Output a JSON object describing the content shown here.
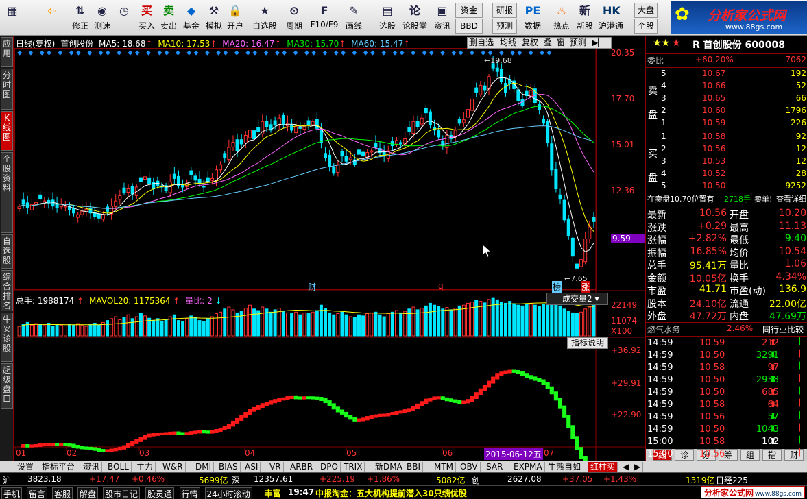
{
  "toolbar": {
    "buttons": [
      {
        "label": "",
        "icon": "grid-icon"
      },
      {
        "label": "",
        "icon": "back-arrow-icon"
      },
      {
        "label": "修正",
        "icon": "up-down-icon"
      },
      {
        "label": "测速",
        "icon": "speed-icon"
      },
      {
        "label": "",
        "icon": "clock-icon"
      },
      {
        "label": "买入",
        "icon": "buy-icon",
        "glyph": "买"
      },
      {
        "label": "卖出",
        "icon": "sell-icon",
        "glyph": "卖"
      },
      {
        "label": "基金",
        "icon": "fund-icon"
      },
      {
        "label": "模拟",
        "icon": "hammer-icon"
      },
      {
        "label": "开户",
        "icon": "lock-icon"
      },
      {
        "label": "自选股",
        "icon": "star-list-icon"
      },
      {
        "label": "周期",
        "icon": "period-icon"
      },
      {
        "label": "F10/F9",
        "icon": "f10-icon"
      },
      {
        "label": "画线",
        "icon": "pen-icon"
      },
      {
        "label": "选股",
        "icon": "select-icon"
      },
      {
        "label": "论股堂",
        "icon": "discuss-icon"
      },
      {
        "label": "资讯",
        "icon": "news-icon"
      },
      {
        "label": "资金",
        "icon": "funds-icon"
      },
      {
        "label": "BBD",
        "icon": "bbd-icon"
      },
      {
        "label": "研报",
        "icon": "report-icon"
      },
      {
        "label": "预测",
        "icon": "forecast-icon"
      },
      {
        "label": "数据",
        "icon": "pe-icon",
        "glyph": "PE"
      },
      {
        "label": "热点",
        "icon": "fire-icon"
      },
      {
        "label": "新股",
        "icon": "new-stock-icon"
      },
      {
        "label": "沪港通",
        "icon": "hk-icon"
      },
      {
        "label": "大盘",
        "icon": "market-icon"
      },
      {
        "label": "个股",
        "icon": "stock-icon"
      }
    ],
    "brand": "分析家公式网",
    "brand_url": "www.88gs.com"
  },
  "lefttabs": [
    "应用",
    "分时图",
    "K线图",
    "个股资料",
    "自选股",
    "综合排名",
    "牛叉诊股",
    "超级盘口"
  ],
  "chart": {
    "header": {
      "period": "日线(复权)",
      "name": "首创股份",
      "ma5": "MA5: 18.68",
      "ma10": "MA10: 17.53",
      "ma20": "MA20: 16.47",
      "ma30": "MA30: 15.70",
      "ma60": "MA60: 15.47"
    },
    "tools": [
      "删自选",
      "均线",
      "复权",
      "叠",
      "窗",
      "预测"
    ],
    "price_axis": [
      "20.35",
      "17.70",
      "15.01",
      "12.36",
      "9.59"
    ],
    "hi_label": "19.68",
    "lo_label": "7.65",
    "marks": [
      "财",
      "q",
      "榜",
      "涨"
    ],
    "vol_header": {
      "total": "总手: 1988174",
      "mavol": "MAVOL20: 1175364",
      "ratio": "量比: 2"
    },
    "vol_selector": "成交量2",
    "vol_axis": [
      "22149",
      "11074",
      "X100"
    ],
    "ind_btn": "指标说明",
    "ind_axis": [
      "+36.92",
      "+29.91",
      "+22.90"
    ],
    "months": [
      "01",
      "02",
      "03",
      "04",
      "05",
      "06",
      "07"
    ],
    "date_tag": "2015-06-12五"
  },
  "chart_data": {
    "type": "candlestick",
    "ylim": [
      7.0,
      20.5
    ],
    "closes": [
      11.5,
      11.6,
      11.4,
      11.6,
      11.7,
      11.9,
      11.8,
      11.7,
      11.5,
      11.4,
      11.6,
      11.5,
      11.3,
      11.1,
      11.0,
      11.2,
      11.3,
      11.1,
      10.9,
      10.8,
      11.0,
      11.2,
      11.5,
      11.8,
      12.1,
      12.3,
      12.5,
      12.2,
      12.6,
      12.9,
      13.2,
      12.8,
      12.5,
      12.7,
      12.6,
      12.4,
      12.9,
      13.1,
      12.7,
      12.6,
      12.8,
      13.3,
      13.0,
      12.8,
      12.6,
      12.9,
      13.1,
      13.6,
      13.9,
      14.3,
      14.9,
      15.2,
      14.7,
      15.1,
      15.6,
      15.9,
      15.4,
      15.8,
      16.4,
      16.1,
      15.9,
      16.2,
      16.6,
      16.2,
      16.3,
      15.9,
      16.1,
      16.0,
      16.1,
      16.2,
      16.4,
      16.0,
      15.2,
      14.3,
      13.8,
      13.4,
      13.9,
      14.4,
      14.1,
      14.3,
      13.9,
      14.5,
      14.4,
      14.6,
      14.7,
      14.9,
      14.6,
      14.4,
      14.7,
      15.0,
      15.3,
      15.1,
      15.4,
      15.8,
      16.4,
      16.1,
      16.6,
      16.9,
      16.2,
      15.9,
      15.5,
      15.0,
      15.6,
      15.4,
      15.9,
      16.3,
      16.5,
      17.1,
      17.7,
      18.1,
      18.5,
      18.2,
      19.0,
      19.5,
      19.3,
      18.7,
      18.1,
      18.6,
      18.3,
      17.6,
      17.3,
      17.9,
      18.2,
      17.5,
      17.1,
      16.3,
      15.2,
      13.6,
      12.5,
      11.9,
      10.7,
      9.8,
      8.6,
      7.9,
      8.4,
      9.6,
      10.3,
      10.6
    ],
    "volumes": [
      25,
      30,
      35,
      28,
      32,
      30,
      27,
      33,
      25,
      30,
      28,
      26,
      30,
      28,
      32,
      27,
      25,
      30,
      33,
      28,
      35,
      40,
      45,
      50,
      42,
      48,
      55,
      45,
      50,
      58,
      52,
      46,
      40,
      45,
      38,
      42,
      50,
      55,
      40,
      38,
      45,
      52,
      48,
      40,
      38,
      45,
      50,
      58,
      62,
      70,
      75,
      68,
      60,
      65,
      72,
      80,
      70,
      66,
      75,
      70,
      62,
      68,
      72,
      65,
      60,
      58,
      62,
      55,
      60,
      58,
      62,
      66,
      80,
      72,
      60,
      55,
      58,
      62,
      55,
      50,
      48,
      55,
      52,
      58,
      60,
      62,
      55,
      50,
      58,
      62,
      66,
      60,
      64,
      70,
      75,
      68,
      72,
      78,
      85,
      80,
      76,
      70,
      74,
      68,
      72,
      78,
      80,
      85,
      88,
      92,
      90,
      86,
      95,
      98,
      94,
      88,
      85,
      90,
      84,
      80,
      78,
      82,
      85,
      80,
      76,
      82,
      88,
      92,
      85,
      78,
      70,
      65,
      60,
      58,
      62,
      70,
      75,
      80,
      72
    ]
  },
  "quote": {
    "title": "R 首创股份 600008",
    "webi": "委比",
    "webi_val": "+60.20%",
    "webi_diff": "7062",
    "sell_label": [
      "卖",
      "盘"
    ],
    "buy_label": [
      "买",
      "盘"
    ],
    "sells": [
      {
        "lvl": "5",
        "p": "10.67",
        "v": "192"
      },
      {
        "lvl": "4",
        "p": "10.66",
        "v": "52"
      },
      {
        "lvl": "3",
        "p": "10.65",
        "v": "66"
      },
      {
        "lvl": "2",
        "p": "10.60",
        "v": "1796"
      },
      {
        "lvl": "1",
        "p": "10.59",
        "v": "226"
      }
    ],
    "buys": [
      {
        "lvl": "1",
        "p": "10.58",
        "v": "92"
      },
      {
        "lvl": "2",
        "p": "10.56",
        "v": "12"
      },
      {
        "lvl": "3",
        "p": "10.53",
        "v": "12"
      },
      {
        "lvl": "4",
        "p": "10.52",
        "v": "28"
      },
      {
        "lvl": "5",
        "p": "10.50",
        "v": "9252"
      }
    ],
    "info": "在卖盘10.70位置有",
    "info_vol": "2718手",
    "info_tail": "卖单!",
    "info_link": "查看详细",
    "stats": [
      {
        "k1": "最新",
        "v1": "10.56",
        "k2": "开盘",
        "v2": "10.20"
      },
      {
        "k1": "涨跌",
        "v1": "+0.29",
        "k2": "最高",
        "v2": "11.13"
      },
      {
        "k1": "涨幅",
        "v1": "+2.82%",
        "k2": "最低",
        "v2": "9.40"
      },
      {
        "k1": "振幅",
        "v1": "16.85%",
        "k2": "均价",
        "v2": "10.54"
      },
      {
        "k1": "总手",
        "v1": "95.41万",
        "k2": "量比",
        "v2": "1.06"
      },
      {
        "k1": "金额",
        "v1": "10.05亿",
        "k2": "换手",
        "v2": "4.34%"
      },
      {
        "k1": "市盈",
        "v1": "41.71",
        "k2": "市盈(动)",
        "v2": "136.9"
      },
      {
        "k1": "股本",
        "v1": "24.10亿",
        "k2": "流通",
        "v2": "22.00亿"
      },
      {
        "k1": "外盘",
        "v1": "47.72万",
        "k2": "内盘",
        "v2": "47.69万"
      }
    ],
    "sector": "燃气水务",
    "sector_pct": "2.46%",
    "sector_cmp": "同行业比较",
    "ticks": [
      {
        "t": "14:59",
        "p": "10.59",
        "v": "212",
        "d": "up"
      },
      {
        "t": "14:59",
        "p": "10.50",
        "v": "3291",
        "d": "down"
      },
      {
        "t": "14:59",
        "p": "10.58",
        "v": "97",
        "d": "up"
      },
      {
        "t": "14:59",
        "p": "10.50",
        "v": "2938",
        "d": "down"
      },
      {
        "t": "14:59",
        "p": "10.50",
        "v": "685",
        "d": "up"
      },
      {
        "t": "14:59",
        "p": "10.58",
        "v": "64",
        "d": "up"
      },
      {
        "t": "14:59",
        "p": "10.56",
        "v": "57",
        "d": "down"
      },
      {
        "t": "14:59",
        "p": "10.50",
        "v": "1043",
        "d": "down"
      },
      {
        "t": "15:00",
        "p": "10.58",
        "v": "102",
        "d": "neutral"
      },
      {
        "t": "15:00",
        "p": "10.56",
        "v": "",
        "d": "dash"
      }
    ],
    "quick_tabs": [
      "细",
      "诊",
      "分",
      "筹",
      "组",
      "指",
      "财"
    ]
  },
  "bottom_tabs": [
    "设置",
    "指标平台",
    "资讯",
    "BOLL",
    "主力",
    "W&R",
    "DMI",
    "BIAS",
    "ASI",
    "VR",
    "ARBR",
    "DPO",
    "TRIX",
    "新DMA",
    "BBI",
    "MTM",
    "OBV",
    "SAR",
    "EXPMA",
    "牛熊自如",
    "红柱买"
  ],
  "status1": {
    "sh_label": "沪",
    "sh": "3823.18",
    "sh_chg": "+17.47",
    "sh_pct": "+0.46%",
    "sh_amt": "5699亿",
    "sz_label": "深",
    "sz": "12357.61",
    "sz_chg": "+225.19",
    "sz_pct": "+1.86%",
    "sz_amt": "5082亿",
    "cy_label": "创",
    "cy": "2627.08",
    "cy_chg": "+37.05",
    "cy_pct": "+1.43%",
    "cy_amt": "1319亿",
    "nk_label": "日经225"
  },
  "status2": {
    "items": [
      "手机",
      "留言",
      "客服",
      "解盘",
      "股市日记",
      "股灵通",
      "行情",
      "24小时滚动"
    ],
    "brand": "丰富",
    "time": "19:47",
    "ticker": "中报淘金：五大机构提前潜入30只绩优股",
    "logo": "分析家公式网",
    "logo_url": "www.88gs.com"
  },
  "colors": {
    "up": "#ff3232",
    "down": "#00e6ff",
    "ma5": "#ffffff",
    "ma10": "#ffff00",
    "ma20": "#ff66ff",
    "ma30": "#00ff00",
    "ma60": "#66ccff"
  }
}
